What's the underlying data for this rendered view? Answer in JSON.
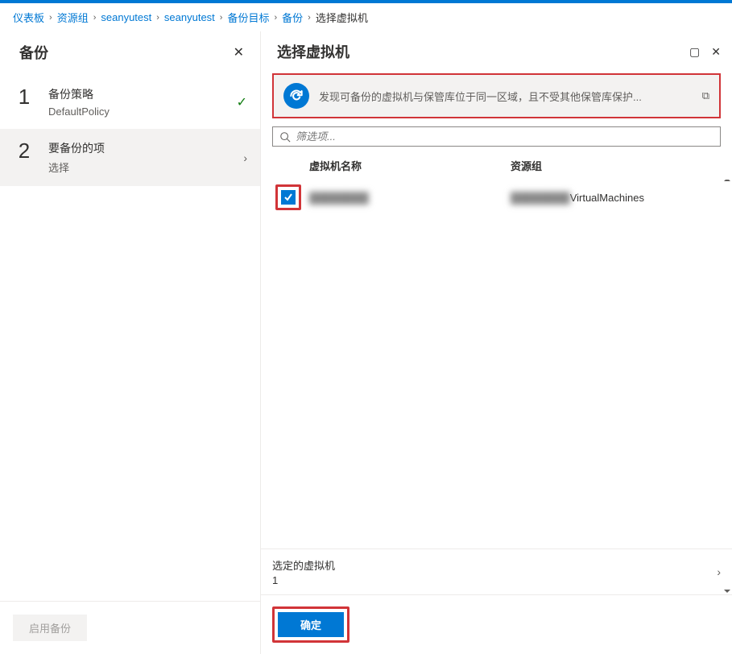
{
  "breadcrumb": {
    "items": [
      "仪表板",
      "资源组",
      "seanyutest",
      "seanyutest",
      "备份目标",
      "备份"
    ],
    "current": "选择虚拟机"
  },
  "left": {
    "title": "备份",
    "steps": [
      {
        "num": "1",
        "title": "备份策略",
        "sub": "DefaultPolicy",
        "state_icon": "check"
      },
      {
        "num": "2",
        "title": "要备份的项",
        "sub": "选择",
        "state_icon": "chevron"
      }
    ],
    "footer_button": "启用备份"
  },
  "right": {
    "title": "选择虚拟机",
    "info_text": "发现可备份的虚拟机与保管库位于同一区域，且不受其他保管库保护...",
    "filter_placeholder": "筛选项...",
    "columns": {
      "name": "虚拟机名称",
      "rg": "资源组"
    },
    "rows": [
      {
        "checked": true,
        "name": "████████",
        "rg_suffix": "VirtualMachines"
      }
    ],
    "selected": {
      "label": "选定的虚拟机",
      "count": "1"
    },
    "ok_button": "确定"
  }
}
